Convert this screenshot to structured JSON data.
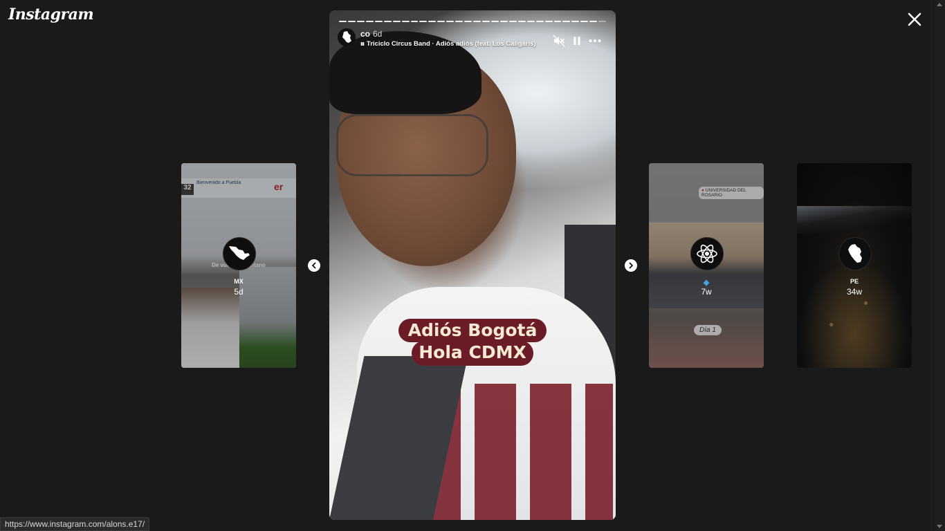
{
  "app": {
    "logo": "Instagram"
  },
  "story": {
    "username": "co",
    "time_ago": "6d",
    "music": "Triciclo Circus Band · Adiós adiós (feat. Los Caligaris)",
    "sticker_line1": "Adiós Bogotá",
    "sticker_line2": "Hola CDMX",
    "progress_segments": 30,
    "progress_filled": 29
  },
  "thumbnails": [
    {
      "name": "MX",
      "time": "5d",
      "banner_text": "Bienvenido a Puebla",
      "banner_number": "32",
      "banner_logo": "er",
      "caption": "De vuelta al pantano"
    },
    {
      "name": "",
      "time": "7w",
      "location_tag": "UNIVERSIDAD DEL ROSARIO",
      "pill": "Día 1"
    },
    {
      "name": "PE",
      "time": "34w"
    }
  ],
  "status_bar": {
    "url": "https://www.instagram.com/alons.e17/"
  },
  "colors": {
    "background": "#1a1a1a",
    "sticker_bg": "#6c1c27",
    "sticker_text": "#f6ead5"
  },
  "icons": [
    "close-icon",
    "mute-icon",
    "pause-icon",
    "more-icon",
    "chevron-left-icon",
    "chevron-right-icon",
    "colombia-map-icon",
    "mexico-map-icon",
    "atom-icon",
    "peru-map-icon"
  ]
}
